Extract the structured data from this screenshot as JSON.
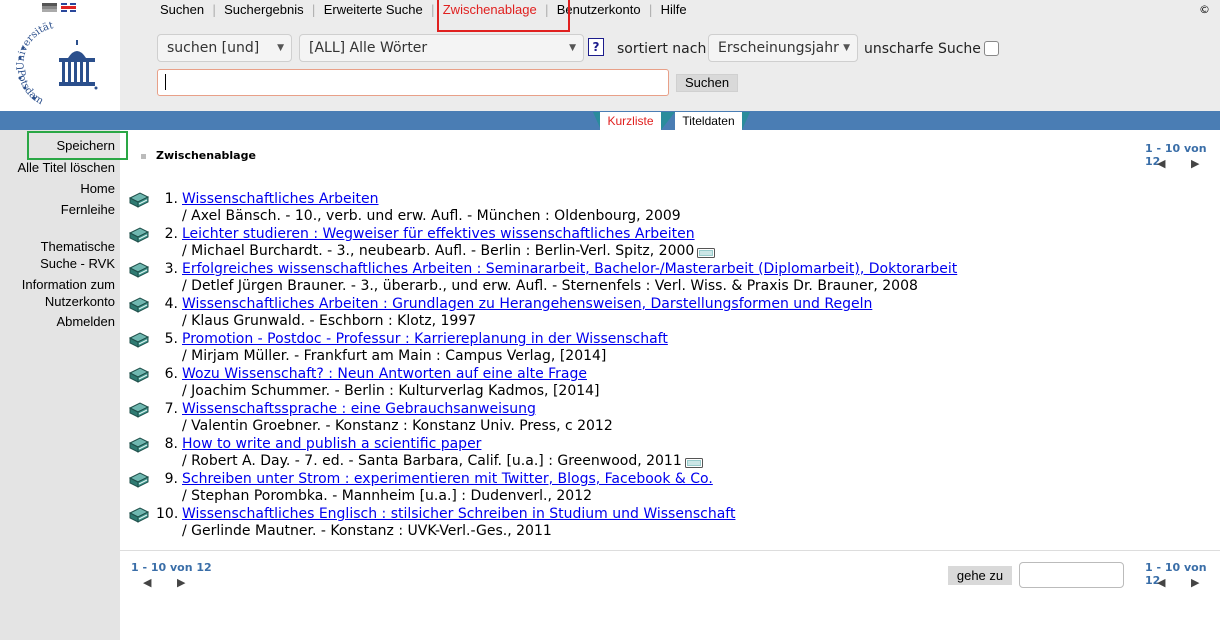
{
  "nav": {
    "items": [
      "Suchen",
      "Suchergebnis",
      "Erweiterte Suche",
      "Zwischenablage",
      "Benutzerkonto",
      "Hilfe"
    ],
    "active": "Zwischenablage",
    "copyright": "©"
  },
  "logo": {
    "text_top": "Universität",
    "text_bottom": "Potsdam"
  },
  "search": {
    "operator": "suchen [und]",
    "field": "[ALL] Alle Wörter",
    "help": "?",
    "sort_label": "sortiert nach",
    "sort_value": "Erscheinungsjahr",
    "fuzzy_label": "unscharfe Suche",
    "fuzzy_checked": false,
    "query": "",
    "button": "Suchen"
  },
  "view_tabs": {
    "short": "Kurzliste",
    "detail": "Titeldaten",
    "active": "short"
  },
  "sidebar": {
    "items": [
      "Speichern",
      "Alle Titel löschen",
      "Home",
      "Fernleihe",
      "Thematische Suche - RVK",
      "Information zum Nutzerkonto",
      "Abmelden"
    ]
  },
  "main": {
    "heading": "Zwischenablage",
    "pager_text": "1 - 10 von 12",
    "goto_button": "gehe zu",
    "results": [
      {
        "num": "1.",
        "title": "Wissenschaftliches Arbeiten",
        "meta": "/ Axel Bänsch. - 10., verb. und erw. Aufl. - München : Oldenbourg, 2009",
        "ebook": false
      },
      {
        "num": "2.",
        "title": "Leichter studieren : Wegweiser für effektives wissenschaftliches Arbeiten",
        "meta": "/ Michael Burchardt. - 3., neubearb. Aufl. - Berlin : Berlin-Verl. Spitz, 2000",
        "ebook": true
      },
      {
        "num": "3.",
        "title": "Erfolgreiches wissenschaftliches Arbeiten : Seminararbeit, Bachelor-/Masterarbeit (Diplomarbeit), Doktorarbeit",
        "meta": "/ Detlef Jürgen Brauner. - 3., überarb., und erw. Aufl. - Sternenfels : Verl. Wiss. & Praxis Dr. Brauner, 2008",
        "ebook": false
      },
      {
        "num": "4.",
        "title": "Wissenschaftliches Arbeiten : Grundlagen zu Herangehensweisen, Darstellungsformen und Regeln",
        "meta": "/ Klaus Grunwald. - Eschborn : Klotz, 1997",
        "ebook": false
      },
      {
        "num": "5.",
        "title": "Promotion - Postdoc - Professur : Karriereplanung in der Wissenschaft",
        "meta": "/ Mirjam Müller. - Frankfurt am Main : Campus Verlag, [2014]",
        "ebook": false
      },
      {
        "num": "6.",
        "title": "Wozu Wissenschaft? : Neun Antworten auf eine alte Frage",
        "meta": "/ Joachim Schummer. - Berlin : Kulturverlag Kadmos, [2014]",
        "ebook": false
      },
      {
        "num": "7.",
        "title": "Wissenschaftssprache : eine Gebrauchsanweisung",
        "meta": "/ Valentin Groebner. - Konstanz : Konstanz Univ. Press, c 2012",
        "ebook": false
      },
      {
        "num": "8.",
        "title": "How to write and publish a scientific paper",
        "meta": "/ Robert A. Day. - 7. ed. - Santa Barbara, Calif. [u.a.] : Greenwood, 2011",
        "ebook": true
      },
      {
        "num": "9.",
        "title": "Schreiben unter Strom : experimentieren mit Twitter, Blogs, Facebook & Co.",
        "meta": "/ Stephan Porombka. - Mannheim [u.a.] : Dudenverl., 2012",
        "ebook": false
      },
      {
        "num": "10.",
        "title": "Wissenschaftliches Englisch : stilsicher Schreiben in Studium und Wissenschaft",
        "meta": "/ Gerlinde Mautner. - Konstanz : UVK-Verl.-Ges., 2011",
        "ebook": false
      }
    ]
  },
  "colors": {
    "accent_red": "#e0201f",
    "band_blue": "#4a7db4",
    "link_blue": "#0000ee",
    "pager_blue": "#3a6ea8",
    "highlight_green": "#2aa745"
  }
}
